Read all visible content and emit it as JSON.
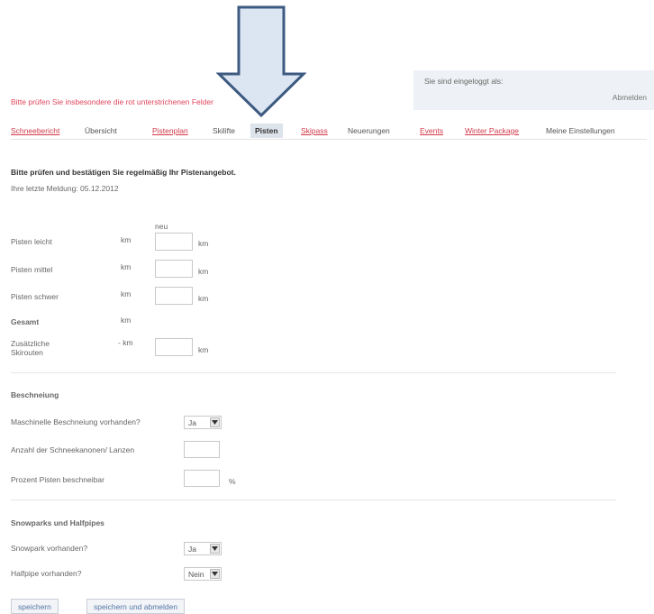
{
  "login": {
    "logged_in_label": "Sie sind eingeloggt als:",
    "logout_label": "Abmelden"
  },
  "warning_text": "Bitte prüfen Sie insbesondere die rot unterstrichenen Felder",
  "nav": {
    "items": [
      {
        "label": "Schneebericht",
        "style": "red"
      },
      {
        "label": "Übersicht",
        "style": "plain"
      },
      {
        "label": "Pistenplan",
        "style": "red"
      },
      {
        "label": "Skilifte",
        "style": "plain"
      },
      {
        "label": "Pisten",
        "style": "active"
      },
      {
        "label": "Skipass",
        "style": "red"
      },
      {
        "label": "Neuerungen",
        "style": "plain"
      },
      {
        "label": "Events",
        "style": "red"
      },
      {
        "label": "Winter Package",
        "style": "red"
      },
      {
        "label": "Meine Einstellungen",
        "style": "plain"
      }
    ]
  },
  "intro": {
    "heading": "Bitte prüfen und bestätigen Sie regelmäßig Ihr Pistenangebot.",
    "last_update": "Ihre letzte Meldung: 05.12.2012"
  },
  "pisten": {
    "new_header": "neu",
    "unit": "km",
    "rows": [
      {
        "label": "Pisten leicht",
        "current": "km",
        "value": ""
      },
      {
        "label": "Pisten mittel",
        "current": "km",
        "value": ""
      },
      {
        "label": "Pisten schwer",
        "current": "km",
        "value": ""
      }
    ],
    "total": {
      "label": "Gesamt",
      "current": "km"
    },
    "extra": {
      "label": "Zusätzliche Skirouten",
      "current": "- km",
      "value": ""
    }
  },
  "beschneiung": {
    "heading": "Beschneiung",
    "machine_label": "Maschinelle Beschneiung vorhanden?",
    "machine_value": "Ja",
    "cannons_label": "Anzahl der Schneekanonen/ Lanzen",
    "cannons_value": "",
    "percent_label": "Prozent Pisten beschneibar",
    "percent_value": "",
    "percent_unit": "%"
  },
  "snowparks": {
    "heading": "Snowparks und Halfpipes",
    "snowpark_label": "Snowpark vorhanden?",
    "snowpark_value": "Ja",
    "halfpipe_label": "Halfpipe vorhanden?",
    "halfpipe_value": "Nein"
  },
  "buttons": {
    "save_label": "speichern",
    "save_logout_label": "speichern und abmelden"
  },
  "colors": {
    "accent_red": "#d23a4b",
    "arrow_fill": "#dce6f2",
    "arrow_stroke": "#3d5a80"
  }
}
